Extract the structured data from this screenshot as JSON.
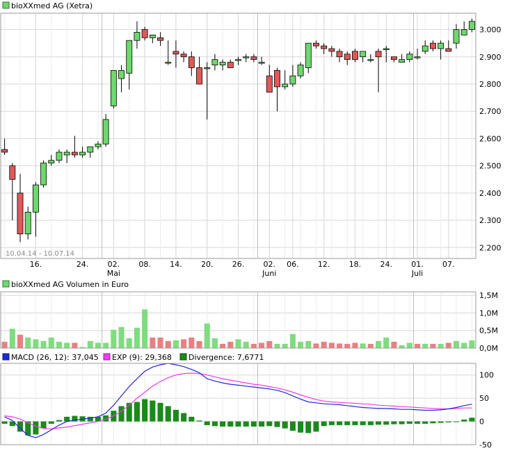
{
  "colors": {
    "up": "#6dd86d",
    "down": "#e35858",
    "upBar": "#7fdc7f",
    "downBar": "#e88080",
    "macd": "#1f28d6",
    "exp": "#ee3bee",
    "divergence": "#1a8a1a",
    "grid": "#d7d7d7",
    "frame": "#9a9a9a"
  },
  "price_panel": {
    "legend": "bioXXmed AG (Xetra)",
    "period": "10.04.14 - 10.07.14",
    "yticks": [
      "3.000",
      "2.900",
      "2.800",
      "2.700",
      "2.600",
      "2.500",
      "2.400",
      "2.300",
      "2.200"
    ],
    "xticks": [
      "16.",
      "24.",
      "02.",
      "08.",
      "14.",
      "20.",
      "26.",
      "02.",
      "06.",
      "12.",
      "18.",
      "24.",
      "01.",
      "07."
    ],
    "months": [
      "Mai",
      "Juni",
      "Juli"
    ]
  },
  "volume_panel": {
    "legend": "bioXXmed AG Volumen in Euro",
    "yticks": [
      "1,5M",
      "1,0M",
      "0,5M",
      "0,0M"
    ]
  },
  "macd_panel": {
    "macd_label": "MACD (26, 12): 37,045",
    "exp_label": "EXP (9): 29,368",
    "div_label": "Divergence: 7,6771",
    "yticks": [
      "100",
      "50",
      "0",
      "-50"
    ]
  },
  "chart_data": [
    {
      "type": "candlestick",
      "title": "bioXXmed AG (Xetra)",
      "period": "10.04.14 - 10.07.14",
      "ylim": [
        2160,
        3060
      ],
      "yticks": [
        2200,
        2300,
        2400,
        2500,
        2600,
        2700,
        2800,
        2900,
        3000
      ],
      "x": [
        "2014-04-10",
        "2014-04-11",
        "2014-04-14",
        "2014-04-15",
        "2014-04-16",
        "2014-04-17",
        "2014-04-22",
        "2014-04-23",
        "2014-04-24",
        "2014-04-25",
        "2014-04-28",
        "2014-04-29",
        "2014-04-30",
        "2014-05-02",
        "2014-05-05",
        "2014-05-06",
        "2014-05-07",
        "2014-05-08",
        "2014-05-09",
        "2014-05-12",
        "2014-05-13",
        "2014-05-14",
        "2014-05-15",
        "2014-05-16",
        "2014-05-19",
        "2014-05-20",
        "2014-05-21",
        "2014-05-22",
        "2014-05-23",
        "2014-05-26",
        "2014-05-27",
        "2014-05-28",
        "2014-05-30",
        "2014-06-02",
        "2014-06-03",
        "2014-06-04",
        "2014-06-05",
        "2014-06-06",
        "2014-06-10",
        "2014-06-11",
        "2014-06-12",
        "2014-06-13",
        "2014-06-16",
        "2014-06-17",
        "2014-06-18",
        "2014-06-19",
        "2014-06-20",
        "2014-06-23",
        "2014-06-24",
        "2014-06-25",
        "2014-06-26",
        "2014-06-27",
        "2014-06-30",
        "2014-07-01",
        "2014-07-02",
        "2014-07-03",
        "2014-07-04",
        "2014-07-07",
        "2014-07-08",
        "2014-07-09",
        "2014-07-10"
      ],
      "open": [
        2560,
        2500,
        2400,
        2250,
        2330,
        2430,
        2510,
        2520,
        2540,
        2550,
        2540,
        2550,
        2570,
        2580,
        2720,
        2820,
        2840,
        2960,
        3000,
        2970,
        2970,
        2880,
        2920,
        2910,
        2900,
        2860,
        2860,
        2870,
        2870,
        2880,
        2890,
        2900,
        2900,
        2880,
        2830,
        2850,
        2790,
        2800,
        2830,
        2860,
        2950,
        2940,
        2930,
        2920,
        2910,
        2920,
        2900,
        2890,
        2920,
        2930,
        2900,
        2880,
        2890,
        2900,
        2920,
        2950,
        2930,
        2930,
        2950,
        2980,
        3000
      ],
      "high": [
        2600,
        2510,
        2470,
        2350,
        2440,
        2520,
        2540,
        2560,
        2560,
        2610,
        2570,
        2560,
        2590,
        2690,
        2830,
        2870,
        2960,
        3030,
        3010,
        2980,
        2990,
        2960,
        2960,
        2920,
        2920,
        2900,
        2880,
        2910,
        2890,
        2890,
        2900,
        2910,
        2910,
        2900,
        2870,
        2860,
        2850,
        2870,
        2880,
        2950,
        2960,
        2950,
        2940,
        2930,
        2920,
        2930,
        2920,
        2910,
        2930,
        2940,
        2900,
        2910,
        2920,
        2930,
        2960,
        2960,
        2960,
        2960,
        3020,
        3030,
        3040
      ],
      "low": [
        2540,
        2300,
        2220,
        2230,
        2240,
        2420,
        2500,
        2510,
        2510,
        2530,
        2530,
        2530,
        2560,
        2570,
        2710,
        2770,
        2780,
        2930,
        2960,
        2950,
        2940,
        2870,
        2860,
        2880,
        2830,
        2820,
        2670,
        2850,
        2850,
        2860,
        2870,
        2880,
        2880,
        2870,
        2790,
        2700,
        2780,
        2790,
        2820,
        2840,
        2930,
        2910,
        2900,
        2880,
        2870,
        2880,
        2880,
        2880,
        2770,
        2880,
        2880,
        2880,
        2880,
        2890,
        2910,
        2920,
        2890,
        2920,
        2930,
        2980,
        2990
      ],
      "close": [
        2550,
        2450,
        2250,
        2330,
        2430,
        2510,
        2520,
        2550,
        2550,
        2540,
        2550,
        2570,
        2580,
        2670,
        2850,
        2850,
        2960,
        2990,
        2970,
        2980,
        2960,
        2880,
        2910,
        2900,
        2860,
        2800,
        2860,
        2890,
        2880,
        2860,
        2890,
        2900,
        2890,
        2880,
        2770,
        2790,
        2800,
        2830,
        2870,
        2950,
        2940,
        2930,
        2920,
        2900,
        2890,
        2890,
        2920,
        2890,
        2900,
        2930,
        2890,
        2890,
        2910,
        2900,
        2940,
        2930,
        2950,
        2920,
        3000,
        3000,
        3030
      ]
    },
    {
      "type": "bar",
      "title": "bioXXmed AG Volumen in Euro",
      "unit": "M",
      "ylim": [
        0,
        1.6
      ],
      "yticks": [
        0,
        0.5,
        1.0,
        1.5
      ],
      "values": [
        0.18,
        0.55,
        0.38,
        0.3,
        0.25,
        0.2,
        0.3,
        0.18,
        0.15,
        0.15,
        0.03,
        0.2,
        0.15,
        0.15,
        0.52,
        0.6,
        0.28,
        0.58,
        1.1,
        0.3,
        0.3,
        0.2,
        0.22,
        0.25,
        0.3,
        0.2,
        0.7,
        0.28,
        0.12,
        0.18,
        0.25,
        0.18,
        0.12,
        0.15,
        0.2,
        0.12,
        0.12,
        0.4,
        0.18,
        0.2,
        0.13,
        0.18,
        0.15,
        0.13,
        0.12,
        0.15,
        0.13,
        0.12,
        0.2,
        0.3,
        0.18,
        0.08,
        0.15,
        0.12,
        0.12,
        0.12,
        0.12,
        0.15,
        0.2,
        0.15,
        0.22
      ],
      "up": [
        false,
        true,
        false,
        true,
        true,
        true,
        true,
        true,
        true,
        false,
        true,
        true,
        true,
        true,
        true,
        true,
        true,
        true,
        true,
        false,
        false,
        false,
        true,
        false,
        false,
        false,
        true,
        true,
        false,
        false,
        true,
        true,
        false,
        false,
        false,
        true,
        true,
        true,
        true,
        true,
        false,
        false,
        false,
        false,
        false,
        false,
        true,
        false,
        true,
        true,
        false,
        true,
        true,
        false,
        true,
        false,
        true,
        false,
        true,
        true,
        true
      ]
    },
    {
      "type": "line",
      "ylim": [
        -50,
        125
      ],
      "yticks": [
        -50,
        0,
        50,
        100
      ],
      "series": [
        {
          "name": "MACD (26, 12): 37,045",
          "values": [
            10,
            2,
            -15,
            -30,
            -35,
            -28,
            -18,
            -8,
            0,
            3,
            5,
            7,
            10,
            18,
            35,
            55,
            75,
            92,
            108,
            117,
            122,
            125,
            122,
            118,
            112,
            105,
            92,
            87,
            83,
            80,
            78,
            76,
            74,
            72,
            70,
            67,
            62,
            55,
            48,
            42,
            40,
            38,
            37,
            36,
            34,
            32,
            30,
            29,
            28,
            28,
            27,
            26,
            26,
            25,
            24,
            24,
            25,
            27,
            30,
            34,
            37
          ]
        },
        {
          "name": "EXP (9): 29,368",
          "values": [
            12,
            10,
            5,
            -3,
            -10,
            -15,
            -16,
            -14,
            -12,
            -9,
            -6,
            -3,
            0,
            5,
            12,
            22,
            35,
            50,
            63,
            76,
            86,
            94,
            100,
            103,
            104,
            103,
            100,
            96,
            92,
            89,
            86,
            83,
            80,
            78,
            75,
            72,
            68,
            63,
            57,
            52,
            47,
            44,
            42,
            41,
            40,
            39,
            38,
            37,
            35,
            34,
            33,
            32,
            31,
            30,
            29,
            28,
            27,
            27,
            28,
            29,
            29
          ]
        },
        {
          "name": "Divergence: 7,6771",
          "values": [
            -5,
            -10,
            -22,
            -30,
            -28,
            -15,
            -5,
            3,
            10,
            12,
            11,
            10,
            10,
            13,
            23,
            33,
            40,
            42,
            48,
            45,
            40,
            33,
            25,
            18,
            10,
            2,
            -8,
            -10,
            -11,
            -11,
            -11,
            -11,
            -11,
            -11,
            -10,
            -12,
            -15,
            -20,
            -24,
            -25,
            -22,
            -10,
            -8,
            -8,
            -8,
            -8,
            -8,
            -8,
            -7,
            -7,
            -6,
            -6,
            -5,
            -5,
            -5,
            -4,
            -3,
            -2,
            0,
            4,
            8
          ]
        }
      ]
    }
  ]
}
